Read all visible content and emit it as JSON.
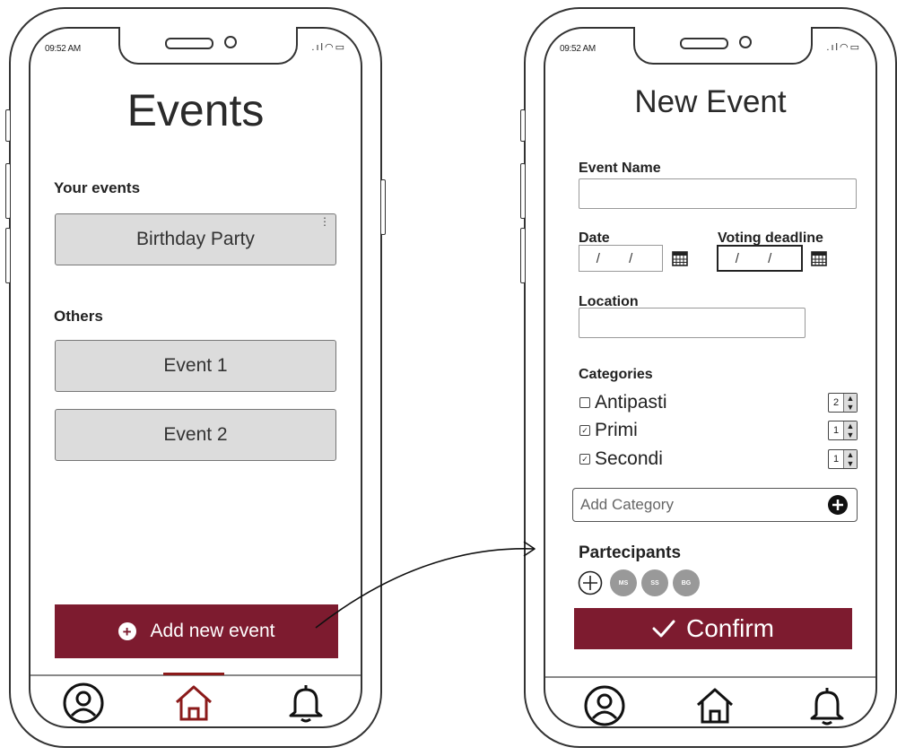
{
  "left_screen": {
    "status_time": "09:52 AM",
    "title": "Events",
    "your_events_label": "Your events",
    "your_events": [
      "Birthday Party"
    ],
    "others_label": "Others",
    "other_events": [
      "Event 1",
      "Event 2"
    ],
    "add_button_label": "Add new event",
    "nav_active": "home"
  },
  "right_screen": {
    "status_time": "09:52 AM",
    "title": "New Event",
    "event_name_label": "Event Name",
    "event_name_value": "",
    "date_label": "Date",
    "date_value": "/ /",
    "voting_deadline_label": "Voting deadline",
    "voting_deadline_value": "/ /",
    "location_label": "Location",
    "location_value": "",
    "categories_label": "Categories",
    "categories": [
      {
        "label": "Antipasti",
        "checked": false,
        "count": "2"
      },
      {
        "label": "Primi",
        "checked": true,
        "count": "1"
      },
      {
        "label": "Secondi",
        "checked": true,
        "count": "1"
      }
    ],
    "add_category_placeholder": "Add Category",
    "participants_label": "Partecipants",
    "participants": [
      "MS",
      "SS",
      "BG"
    ],
    "confirm_label": "Confirm"
  },
  "colors": {
    "accent": "#7d1b2f",
    "card_bg": "#dcdcdc",
    "avatar_bg": "#999999",
    "nav_active": "#8b1a1a"
  },
  "icons": {
    "nav": [
      "user-circle-icon",
      "home-icon",
      "bell-icon"
    ],
    "add": "plus-circle-icon",
    "calendar": "calendar-icon",
    "confirm": "checkmark-icon"
  }
}
